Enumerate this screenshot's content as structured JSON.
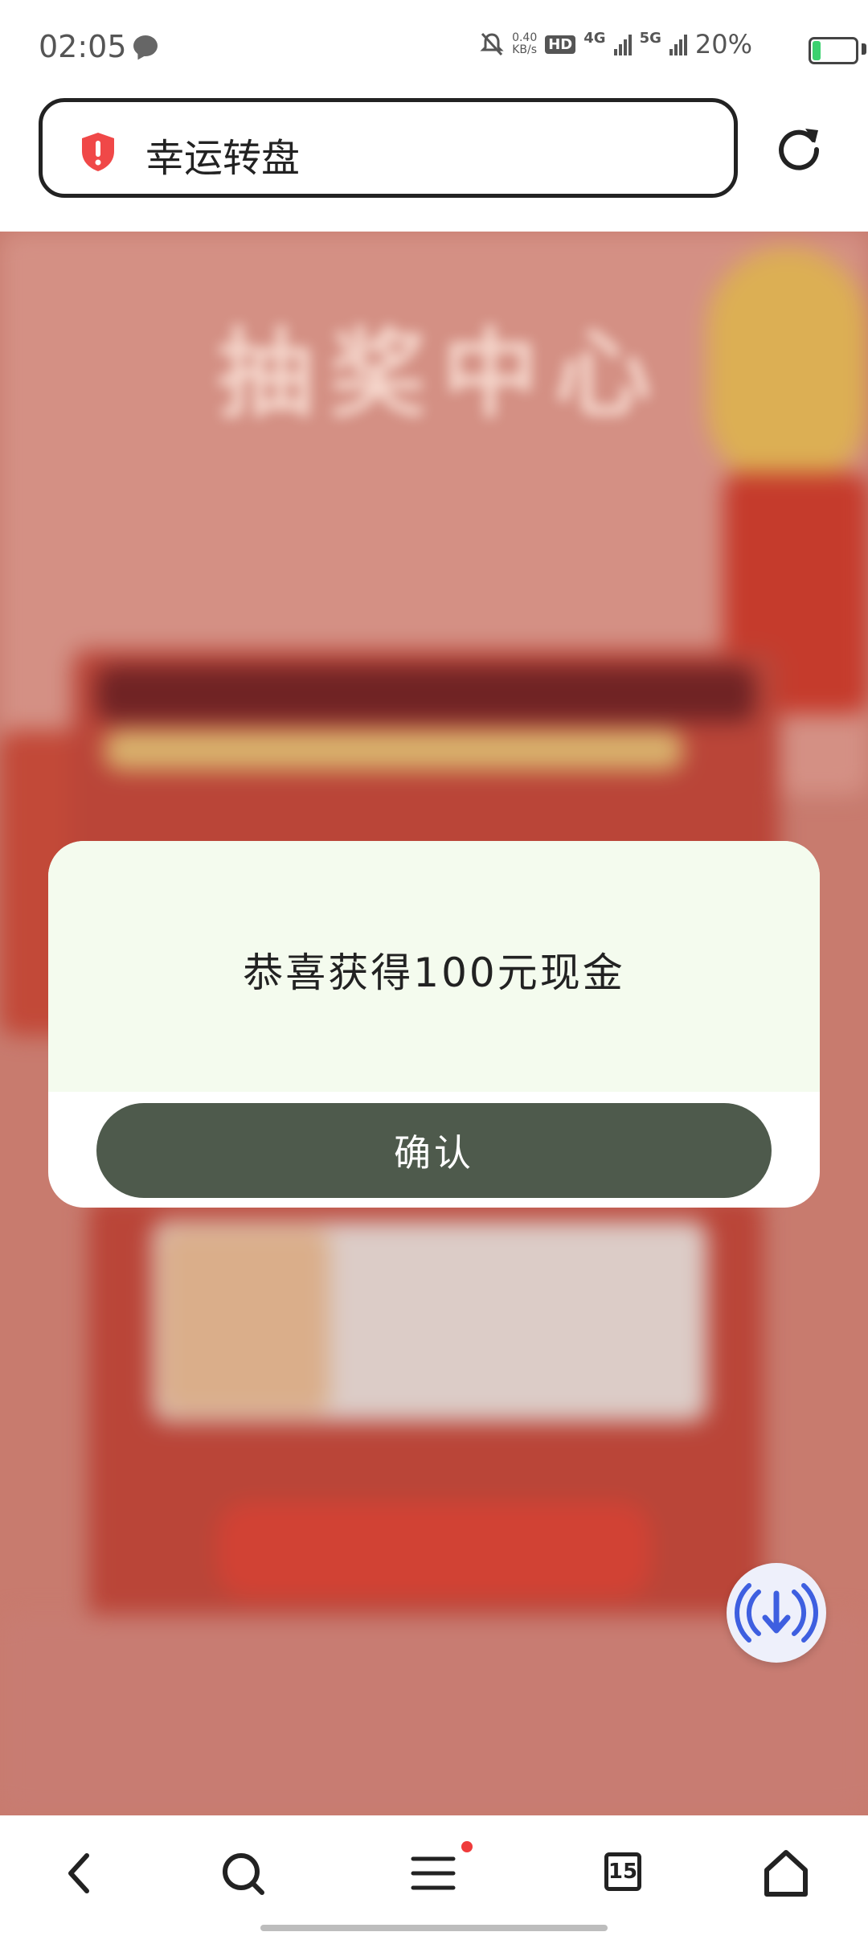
{
  "status_bar": {
    "time": "02:05",
    "net_speed_value": "0.40",
    "net_speed_unit": "KB/s",
    "hd_label": "HD",
    "sim1_label": "4G",
    "sim2_label": "5G",
    "battery_percent_text": "20%",
    "battery_level": 0.2
  },
  "url_bar": {
    "title": "幸运转盘",
    "security_icon": "shield-alert-icon"
  },
  "webpage": {
    "blurred_title": "抽奖中心"
  },
  "dialog": {
    "message": "恭喜获得100元现金",
    "confirm_label": "确认"
  },
  "bottom_nav": {
    "back": "back-icon",
    "search": "search-icon",
    "menu": "menu-icon",
    "tabs_count": "15",
    "home": "home-icon"
  },
  "colors": {
    "dialog_top_bg": "#f4fbee",
    "confirm_button": "#4e5a4c",
    "security_red": "#f04848",
    "fab_icon": "#3e5fe0",
    "menu_badge": "#ef3b3b"
  }
}
